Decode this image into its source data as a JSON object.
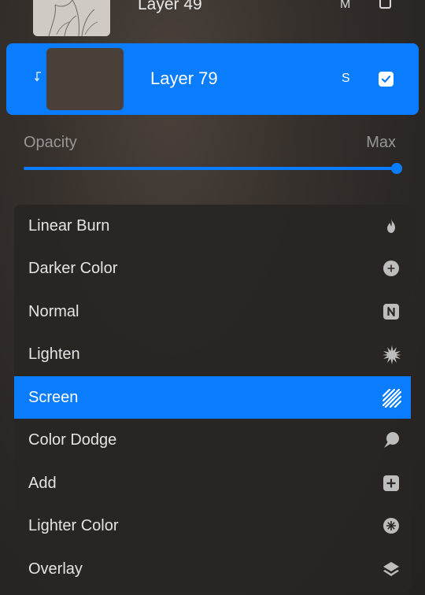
{
  "layers": {
    "top": {
      "name": "Layer 49",
      "mode_letter": "M",
      "visible": false
    },
    "active": {
      "name": "Layer 79",
      "mode_letter": "S",
      "visible": true
    }
  },
  "opacity": {
    "label": "Opacity",
    "value_text": "Max",
    "level": 1.0
  },
  "blend_modes": [
    {
      "label": "Linear Burn",
      "icon": "flame-icon"
    },
    {
      "label": "Darker Color",
      "icon": "plus-circle-icon"
    },
    {
      "label": "Normal",
      "icon": "n-square-icon"
    },
    {
      "label": "Lighten",
      "icon": "starburst-icon"
    },
    {
      "label": "Screen",
      "icon": "stripes-icon",
      "selected": true
    },
    {
      "label": "Color Dodge",
      "icon": "speech-bubble-icon"
    },
    {
      "label": "Add",
      "icon": "plus-square-icon"
    },
    {
      "label": "Lighter Color",
      "icon": "asterisk-circle-icon"
    },
    {
      "label": "Overlay",
      "icon": "layers-icon"
    }
  ],
  "colors": {
    "accent": "#0a7dff",
    "background": "#2b2725",
    "icon_gray": "#bdbdbd"
  }
}
